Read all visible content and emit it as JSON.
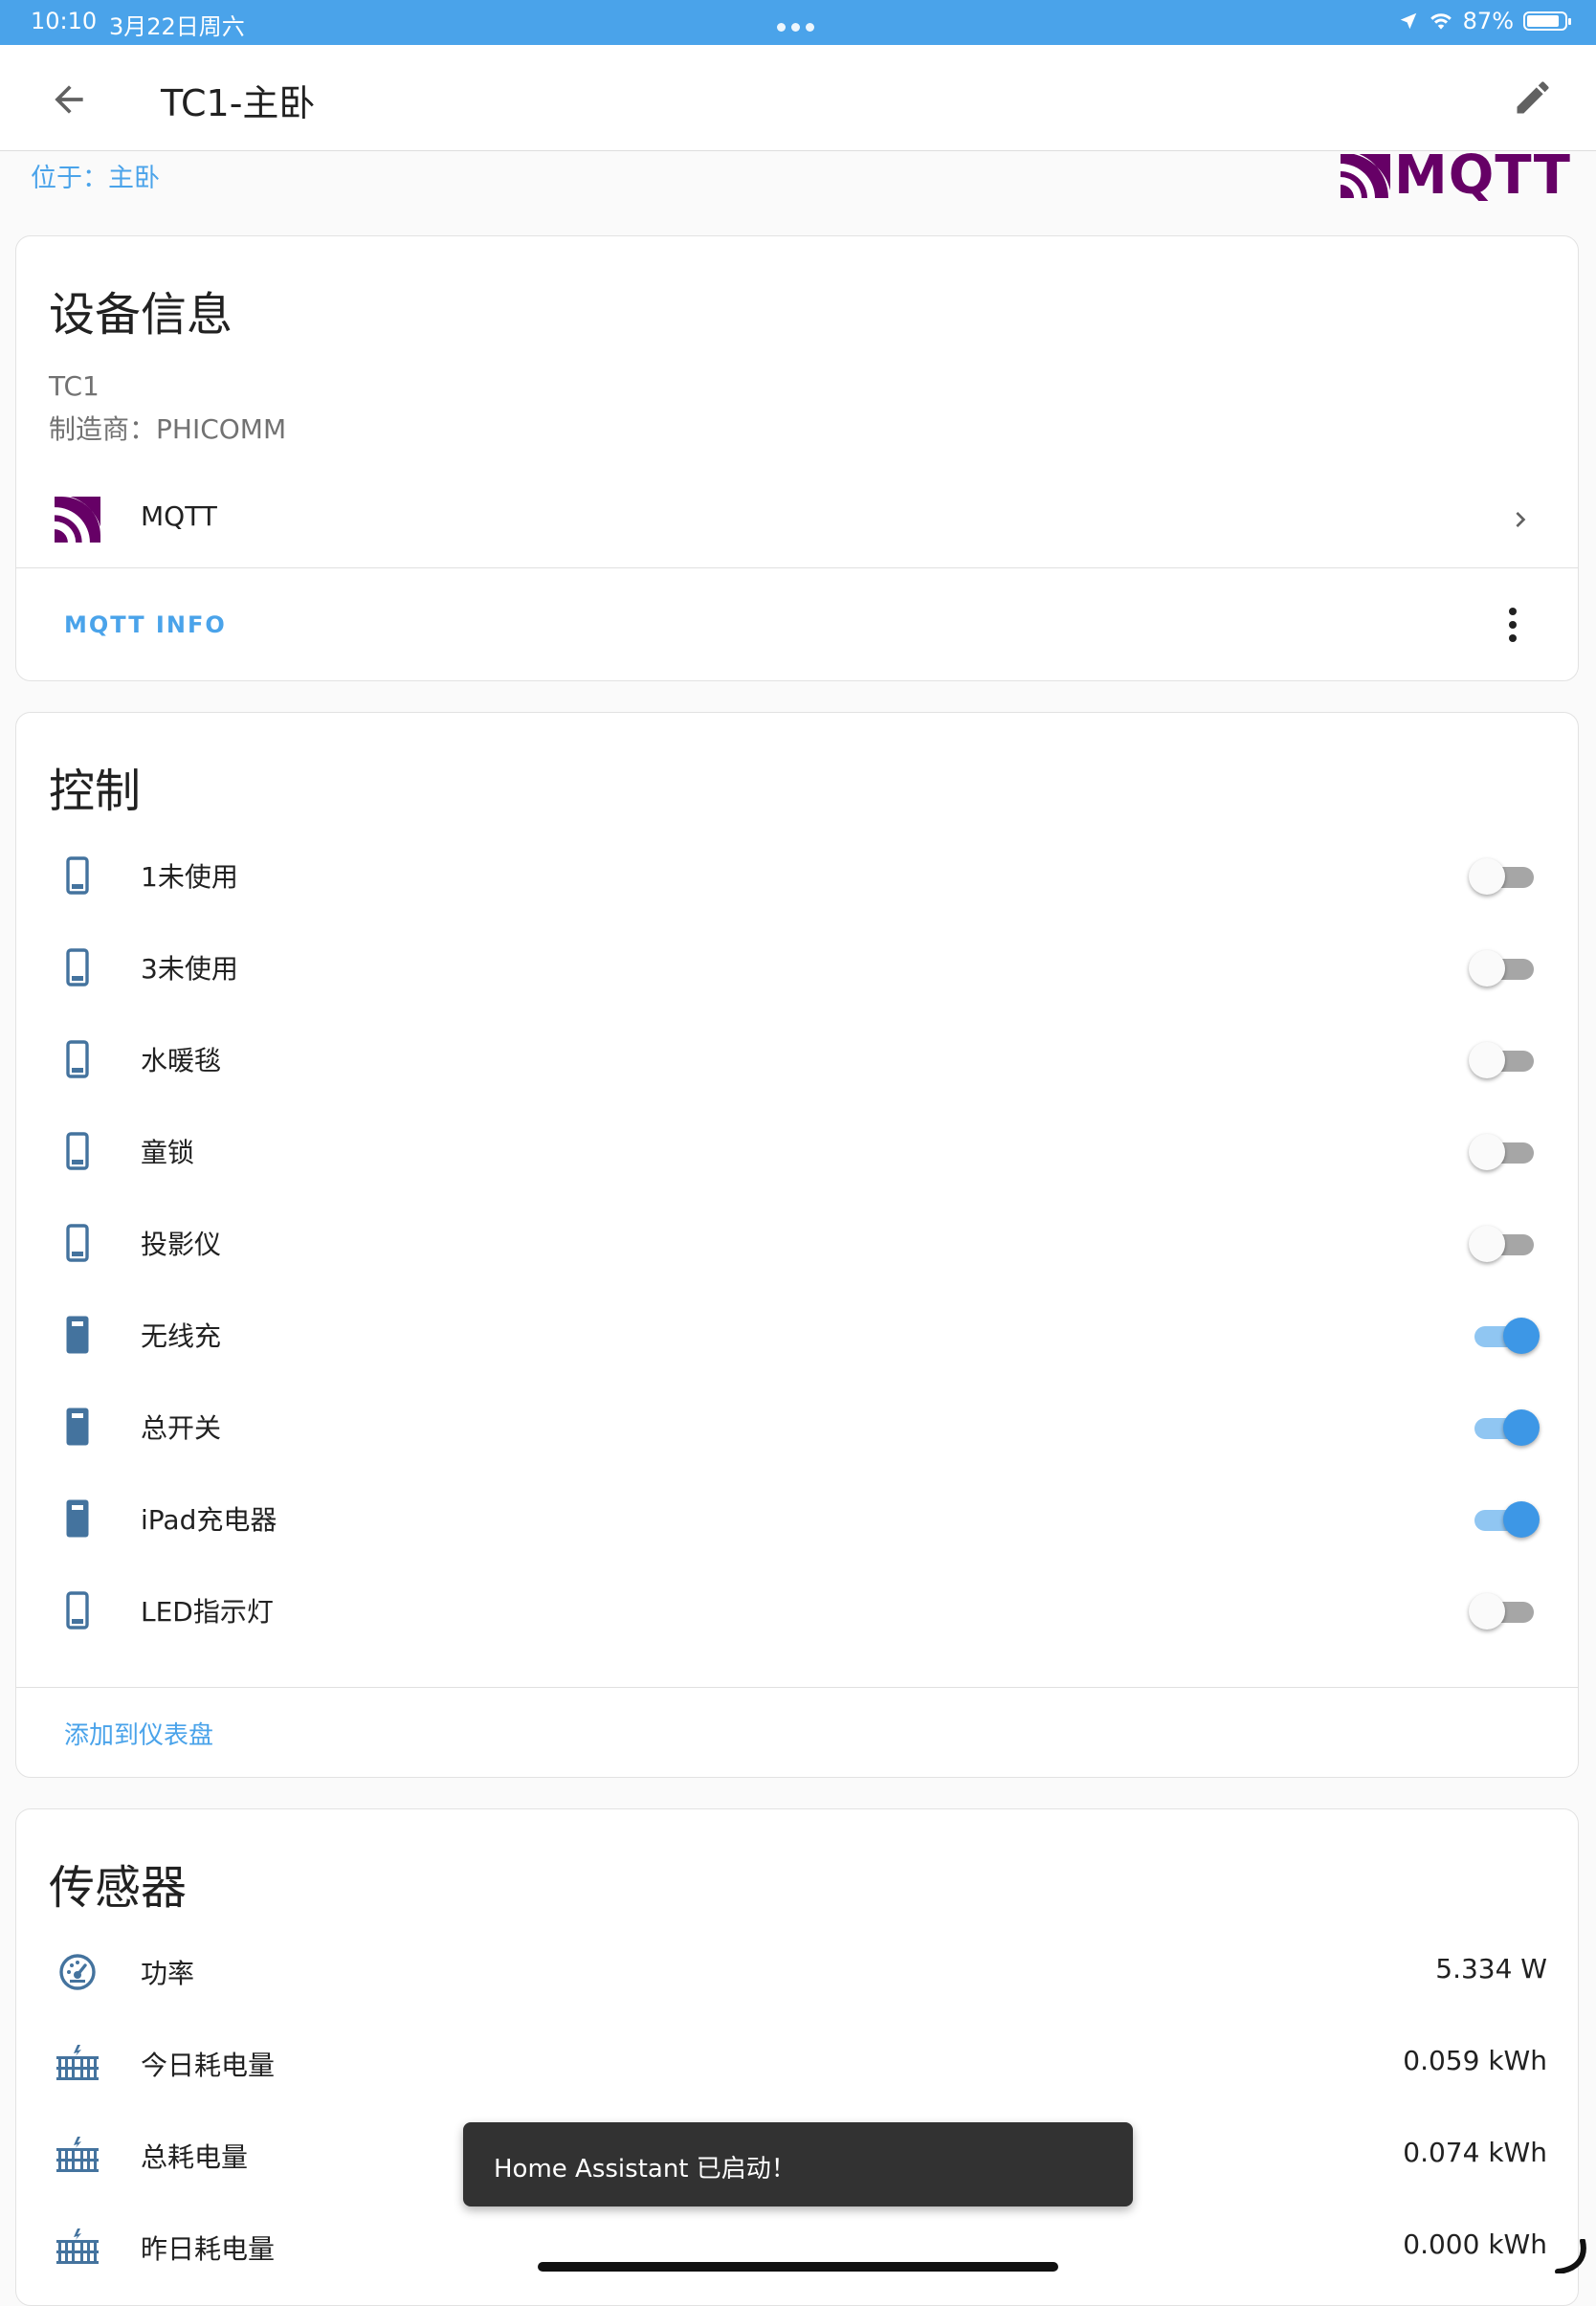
{
  "status_bar": {
    "time": "10:10",
    "date": "3月22日周六",
    "battery": "87%",
    "battery_level": 0.87
  },
  "toolbar": {
    "title": "TC1-主卧"
  },
  "location": "位于：主卧",
  "mqtt_logo": {
    "text": "MQTT",
    "color": "#660066"
  },
  "device_info": {
    "title": "设备信息",
    "model": "TC1",
    "manufacturer": "制造商：PHICOMM",
    "integration": "MQTT",
    "action": "MQTT INFO"
  },
  "controls": {
    "title": "控制",
    "items": [
      {
        "label": "1未使用",
        "on": false
      },
      {
        "label": "3未使用",
        "on": false
      },
      {
        "label": "水暖毯",
        "on": false
      },
      {
        "label": "童锁",
        "on": false
      },
      {
        "label": "投影仪",
        "on": false
      },
      {
        "label": "无线充",
        "on": true
      },
      {
        "label": "总开关",
        "on": true
      },
      {
        "label": "iPad充电器",
        "on": true
      },
      {
        "label": "LED指示灯",
        "on": false
      }
    ],
    "add_to_dashboard": "添加到仪表盘"
  },
  "sensors": {
    "title": "传感器",
    "items": [
      {
        "label": "功率",
        "value": "5.334 W",
        "icon": "gauge-icon"
      },
      {
        "label": "今日耗电量",
        "value": "0.059 kWh",
        "icon": "transmission-tower-icon"
      },
      {
        "label": "总耗电量",
        "value": "0.074 kWh",
        "icon": "transmission-tower-icon"
      },
      {
        "label": "昨日耗电量",
        "value": "0.000 kWh",
        "icon": "transmission-tower-icon"
      }
    ]
  },
  "toast": "Home Assistant 已启动！",
  "colors": {
    "status_bar": "#4aa3ea",
    "accent": "#4aa3ea",
    "toggle_on": "#3d97e6",
    "icon": "#44739e",
    "mqtt_brand": "#660066"
  }
}
